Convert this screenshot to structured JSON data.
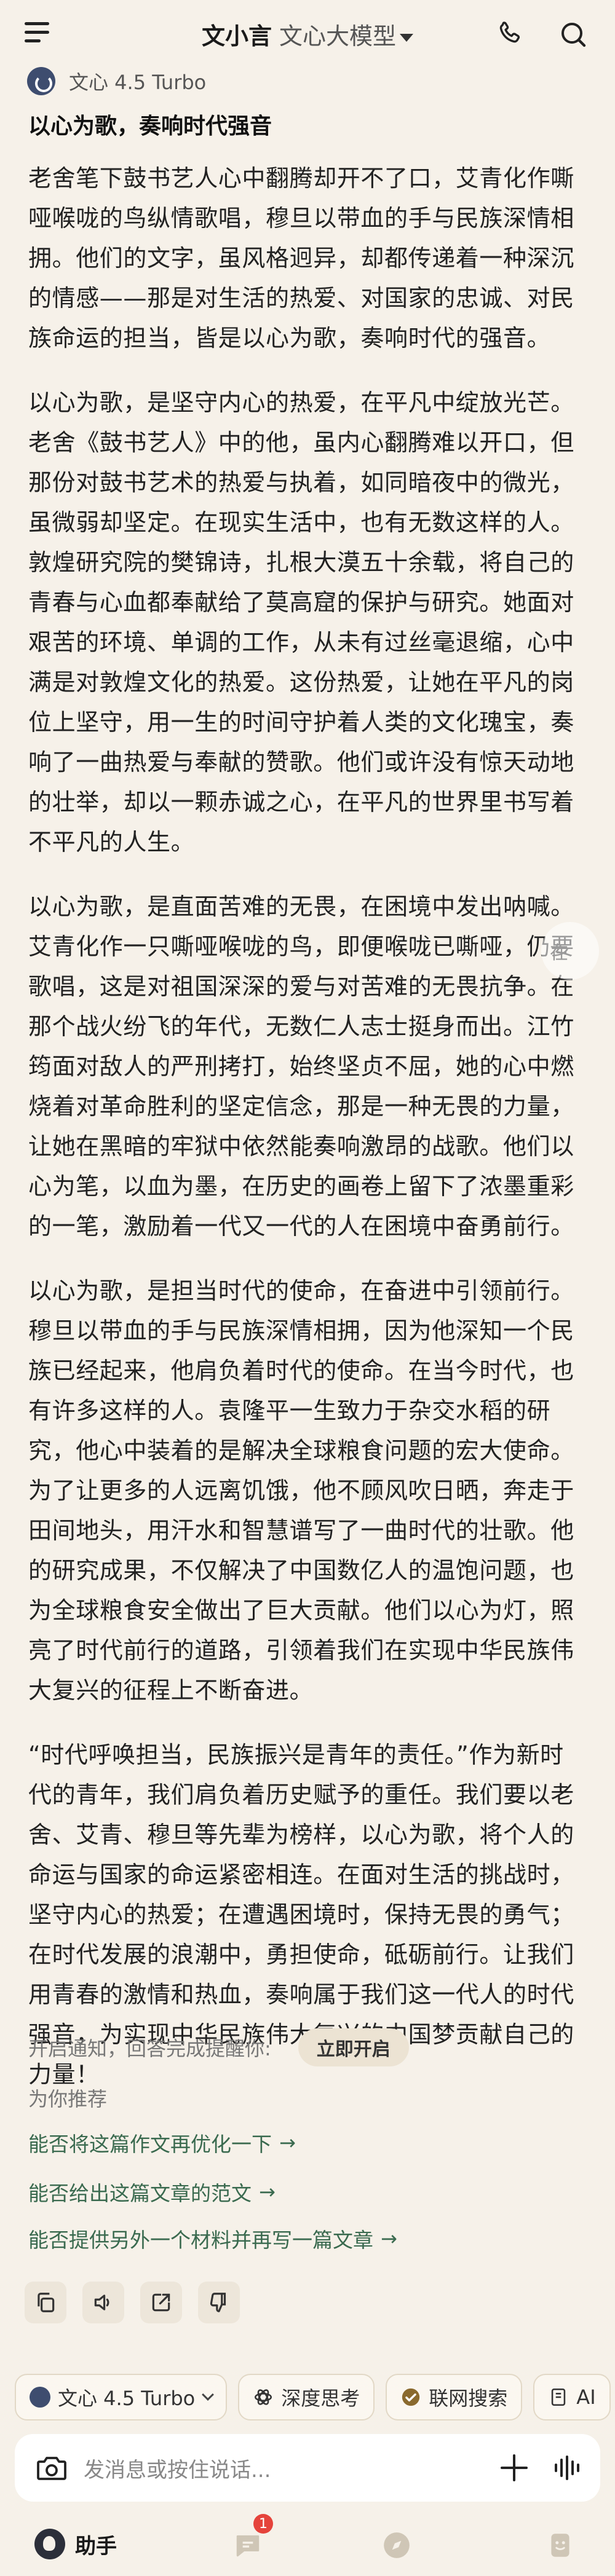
{
  "header": {
    "brand": "文小言",
    "model_label": "文心大模型"
  },
  "message": {
    "model_name": "文心 4.5 Turbo",
    "title": "以心为歌，奏响时代强音",
    "paragraphs": [
      "老舍笔下鼓书艺人心中翻腾却开不了口，艾青化作嘶哑喉咙的鸟纵情歌唱，穆旦以带血的手与民族深情相拥。他们的文字，虽风格迥异，却都传递着一种深沉的情感——那是对生活的热爱、对国家的忠诚、对民族命运的担当，皆是以心为歌，奏响时代的强音。",
      "以心为歌，是坚守内心的热爱，在平凡中绽放光芒。老舍《鼓书艺人》中的他，虽内心翻腾难以开口，但那份对鼓书艺术的热爱与执着，如同暗夜中的微光，虽微弱却坚定。在现实生活中，也有无数这样的人。敦煌研究院的樊锦诗，扎根大漠五十余载，将自己的青春与心血都奉献给了莫高窟的保护与研究。她面对艰苦的环境、单调的工作，从未有过丝毫退缩，心中满是对敦煌文化的热爱。这份热爱，让她在平凡的岗位上坚守，用一生的时间守护着人类的文化瑰宝，奏响了一曲热爱与奉献的赞歌。他们或许没有惊天动地的壮举，却以一颗赤诚之心，在平凡的世界里书写着不平凡的人生。",
      "以心为歌，是直面苦难的无畏，在困境中发出呐喊。艾青化作一只嘶哑喉咙的鸟，即便喉咙已嘶哑，仍要歌唱，这是对祖国深深的爱与对苦难的无畏抗争。在那个战火纷飞的年代，无数仁人志士挺身而出。江竹筠面对敌人的严刑拷打，始终坚贞不屈，她的心中燃烧着对革命胜利的坚定信念，那是一种无畏的力量，让她在黑暗的牢狱中依然能奏响激昂的战歌。他们以心为笔，以血为墨，在历史的画卷上留下了浓墨重彩的一笔，激励着一代又一代的人在困境中奋勇前行。",
      "以心为歌，是担当时代的使命，在奋进中引领前行。穆旦以带血的手与民族深情相拥，因为他深知一个民族已经起来，他肩负着时代的使命。在当今时代，也有许多这样的人。袁隆平一生致力于杂交水稻的研究，他心中装着的是解决全球粮食问题的宏大使命。为了让更多的人远离饥饿，他不顾风吹日晒，奔走于田间地头，用汗水和智慧谱写了一曲时代的壮歌。他的研究成果，不仅解决了中国数亿人的温饱问题，也为全球粮食安全做出了巨大贡献。他们以心为灯，照亮了时代前行的道路，引领着我们在实现中华民族伟大复兴的征程上不断奋进。",
      "“时代呼唤担当，民族振兴是青年的责任。”作为新时代的青年，我们肩负着历史赋予的重任。我们要以老舍、艾青、穆旦等先辈为榜样，以心为歌，将个人的命运与国家的命运紧密相连。在面对生活的挑战时，坚守内心的热爱；在遭遇困境时，保持无畏的勇气；在时代发展的浪潮中，勇担使命，砥砺前行。让我们用青春的激情和热血，奏响属于我们这一代人的时代强音，为实现中华民族伟大复兴的中国梦贡献自己的力量！"
    ],
    "side_handle_text": "在"
  },
  "notify": {
    "text": "开启通知，回答完成提醒你:",
    "button": "立即开启"
  },
  "recommendations": {
    "title": "为你推荐",
    "items": [
      "能否将这篇作文再优化一下",
      "能否给出这篇文章的范文",
      "能否提供另外一个材料并再写一篇文章"
    ],
    "arrow": "→"
  },
  "toolbar_chips": {
    "model": "文心 4.5 Turbo",
    "deep_think": "深度思考",
    "web_search": "联网搜索",
    "partial": "AI"
  },
  "input": {
    "placeholder": "发消息或按住说话..."
  },
  "bottom_nav": {
    "assistant_label": "助手",
    "message_badge": "1"
  },
  "colors": {
    "background": "#f6f1e9",
    "link_green": "#3a6a4f",
    "badge_red": "#e5433b"
  }
}
